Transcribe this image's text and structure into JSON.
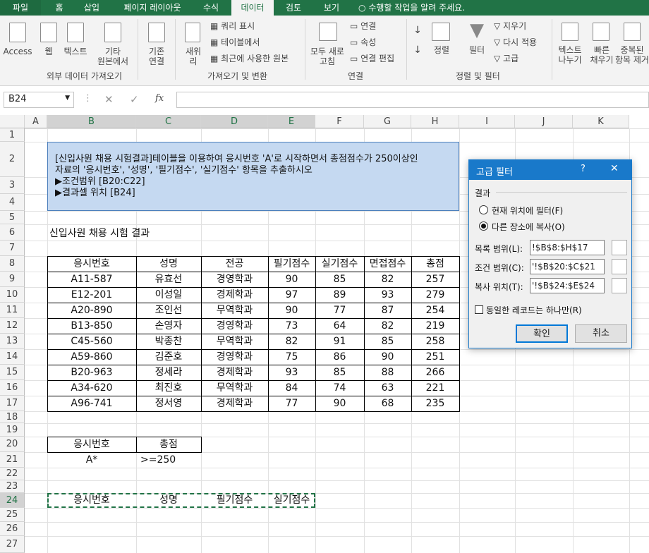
{
  "tabs": [
    "파일",
    "홈",
    "삽입",
    "페이지 레이아웃",
    "수식",
    "데이터",
    "검토",
    "보기"
  ],
  "tell_me": "수행할 작업을 알려 주세요.",
  "ribbon": {
    "ext_access": "Access",
    "ext_web": "웹",
    "ext_text": "텍스트",
    "ext_other": "기타",
    "ext_other2": "원본에서",
    "existing": "기존",
    "existing2": "연결",
    "new": "새위",
    "new2": "리",
    "query_show": "쿼리 표시",
    "from_table": "테이블에서",
    "recent": "최근에 사용한 원본",
    "refresh": "모두 새로",
    "refresh2": "고침",
    "conn": "연결",
    "props": "속성",
    "edit_links": "연결 편집",
    "sort_az": "↓",
    "sort": "정렬",
    "filter": "필터",
    "clear": "지우기",
    "reapply": "다시 적용",
    "advanced": "고급",
    "text_cols": "텍스트",
    "text_cols2": "나누기",
    "flash": "빠른",
    "flash2": "채우기",
    "dup": "중복된",
    "dup2": "항목 제거",
    "grp_external": "외부 데이터 가져오기",
    "grp_transform": "가져오기 및 변환",
    "grp_conn": "연결",
    "grp_sort": "정렬 및 필터"
  },
  "namebox": "B24",
  "fx": "fx",
  "columns": [
    "A",
    "B",
    "C",
    "D",
    "E",
    "F",
    "G",
    "H",
    "I",
    "J",
    "K"
  ],
  "rows": [
    "1",
    "2",
    "3",
    "4",
    "5",
    "6",
    "7",
    "8",
    "9",
    "10",
    "11",
    "12",
    "13",
    "14",
    "15",
    "16",
    "17",
    "18",
    "19",
    "20",
    "21",
    "22",
    "23",
    "24",
    "25",
    "26",
    "27"
  ],
  "instruction": {
    "line1": "[신입사원 채용 시험결과]테이블을 이용하여 응시번호 'A'로 시작하면서 총점점수가 250이상인",
    "line2": "자료의 '응시번호', '성명', '필기점수', '실기점수' 항목을 추출하시오",
    "line3": "▶조건범위 [B20:C22]",
    "line4": "▶결과셀 위치 [B24]"
  },
  "sheet_title": "신입사원 채용 시험 결과",
  "table": {
    "headers": [
      "응시번호",
      "성명",
      "전공",
      "필기점수",
      "실기점수",
      "면접점수",
      "총점"
    ],
    "rows": [
      [
        "A11-587",
        "유효선",
        "경영학과",
        "90",
        "85",
        "82",
        "257"
      ],
      [
        "E12-201",
        "이성일",
        "경제학과",
        "97",
        "89",
        "93",
        "279"
      ],
      [
        "A20-890",
        "조인선",
        "무역학과",
        "90",
        "77",
        "87",
        "254"
      ],
      [
        "B13-850",
        "손영자",
        "경영학과",
        "73",
        "64",
        "82",
        "219"
      ],
      [
        "C45-560",
        "박종찬",
        "무역학과",
        "82",
        "91",
        "85",
        "258"
      ],
      [
        "A59-860",
        "김준호",
        "경영학과",
        "75",
        "86",
        "90",
        "251"
      ],
      [
        "B20-963",
        "정세라",
        "경제학과",
        "93",
        "85",
        "88",
        "266"
      ],
      [
        "A34-620",
        "최진호",
        "무역학과",
        "84",
        "74",
        "63",
        "221"
      ],
      [
        "A96-741",
        "정서영",
        "경제학과",
        "77",
        "90",
        "68",
        "235"
      ]
    ]
  },
  "criteria": {
    "h1": "응시번호",
    "h2": "총점",
    "v1": "A*",
    "v2": ">=250"
  },
  "result_headers": [
    "응시번호",
    "성명",
    "필기점수",
    "실기점수"
  ],
  "dialog": {
    "title": "고급 필터",
    "help": "?",
    "close": "✕",
    "result_label": "결과",
    "opt1": "현재 위치에 필터(F)",
    "opt2": "다른 장소에 복사(O)",
    "list_label": "목록 범위(L):",
    "list_value": "!$B$8:$H$17",
    "crit_label": "조건 범위(C):",
    "crit_value": "'!$B$20:$C$21",
    "copy_label": "복사 위치(T):",
    "copy_value": "'!$B$24:$E$24",
    "unique": "동일한 레코드는 하나만(R)",
    "ok": "확인",
    "cancel": "취소"
  }
}
